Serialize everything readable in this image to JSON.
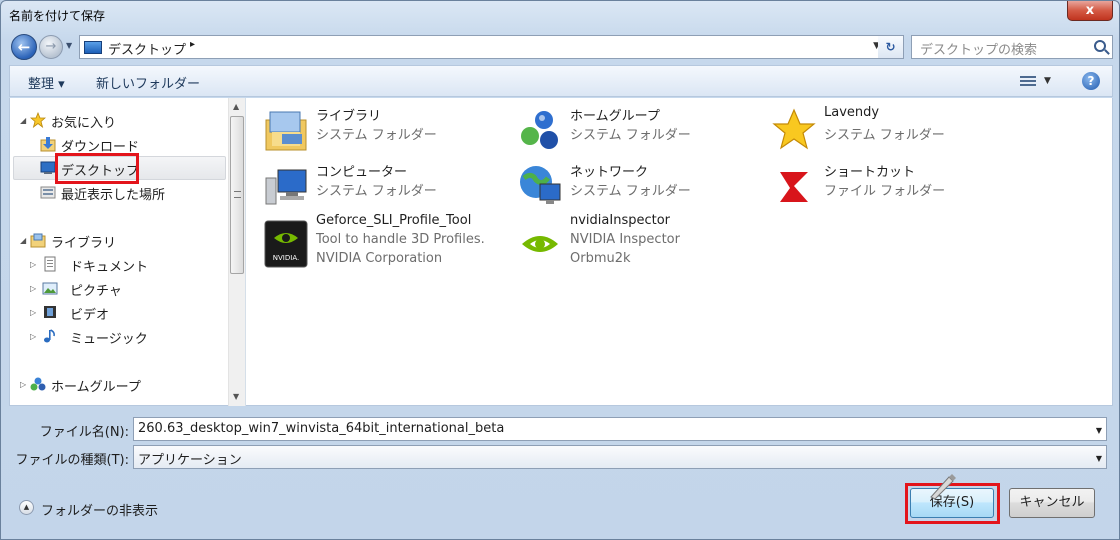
{
  "window": {
    "title": "名前を付けて保存",
    "close_label": "x"
  },
  "address": {
    "location": "デスクトップ",
    "separator": "▸",
    "search_placeholder": "デスクトップの検索"
  },
  "toolbar": {
    "organize_label": "整理 ▾",
    "new_folder_label": "新しいフォルダー",
    "help_label": "?"
  },
  "nav_tree": {
    "favorites": {
      "label": "お気に入り",
      "items": [
        "ダウンロード",
        "デスクトップ",
        "最近表示した場所"
      ]
    },
    "libraries": {
      "label": "ライブラリ",
      "items": [
        "ドキュメント",
        "ピクチャ",
        "ビデオ",
        "ミュージック"
      ]
    },
    "homegroup": {
      "label": "ホームグループ"
    },
    "selected": "デスクトップ"
  },
  "files": [
    {
      "name": "ライブラリ",
      "type": "システム フォルダー",
      "extra": "",
      "icon": "library-icon"
    },
    {
      "name": "ホームグループ",
      "type": "システム フォルダー",
      "extra": "",
      "icon": "homegroup-icon"
    },
    {
      "name": "Lavendy",
      "type": "システム フォルダー",
      "extra": "",
      "icon": "star-icon"
    },
    {
      "name": "コンピューター",
      "type": "システム フォルダー",
      "extra": "",
      "icon": "computer-icon"
    },
    {
      "name": "ネットワーク",
      "type": "システム フォルダー",
      "extra": "",
      "icon": "network-icon"
    },
    {
      "name": "ショートカット",
      "type": "ファイル フォルダー",
      "extra": "",
      "icon": "shortcut-icon"
    },
    {
      "name": "Geforce_SLI_Profile_Tool",
      "type": "Tool to handle 3D Profiles.",
      "extra": "NVIDIA Corporation",
      "icon": "nvidia-icon",
      "badge": "NVIDIA."
    },
    {
      "name": "nvidiaInspector",
      "type": "NVIDIA Inspector",
      "extra": "Orbmu2k",
      "icon": "nvidia-inspector-icon"
    }
  ],
  "form": {
    "filename_label": "ファイル名(N):",
    "filename_value": "260.63_desktop_win7_winvista_64bit_international_beta",
    "filetype_label": "ファイルの種類(T):",
    "filetype_value": "アプリケーション"
  },
  "footer": {
    "hide_folders_label": "フォルダーの非表示",
    "save_label": "保存(S)",
    "cancel_label": "キャンセル"
  },
  "colors": {
    "highlight_box": "#e3141b",
    "title_bar": "#c6d8ec"
  }
}
